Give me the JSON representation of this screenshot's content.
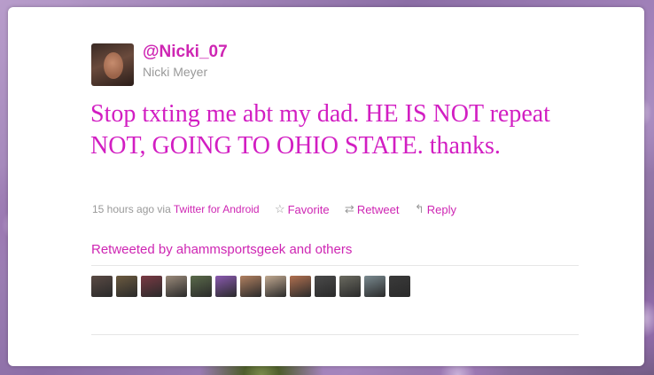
{
  "tweet": {
    "handle": "@Nicki_07",
    "fullname": "Nicki Meyer",
    "text": "Stop txting me abt my dad. HE IS NOT repeat NOT, GOING TO OHIO STATE. thanks.",
    "time": "15 hours ago",
    "via_prefix": "via",
    "client": "Twitter for Android",
    "actions": {
      "favorite": "Favorite",
      "retweet": "Retweet",
      "reply": "Reply"
    },
    "retweeted_by": "Retweeted by ahammsportsgeek and others"
  },
  "retweeter_faces": [
    {
      "color": "#5a4a44"
    },
    {
      "color": "#6b5a40"
    },
    {
      "color": "#7a3a44"
    },
    {
      "color": "#9a8a7a"
    },
    {
      "color": "#5a6a4a"
    },
    {
      "color": "#8a5ab0"
    },
    {
      "color": "#b08060"
    },
    {
      "color": "#c0a890"
    },
    {
      "color": "#b07050"
    },
    {
      "color": "#4a4a4a"
    },
    {
      "color": "#6a6a60"
    },
    {
      "color": "#7a8a90"
    },
    {
      "color": "#3a3a3a"
    }
  ],
  "colors": {
    "link": "#ce26b3",
    "tweet_text": "#d21ec2",
    "muted": "#999999"
  }
}
